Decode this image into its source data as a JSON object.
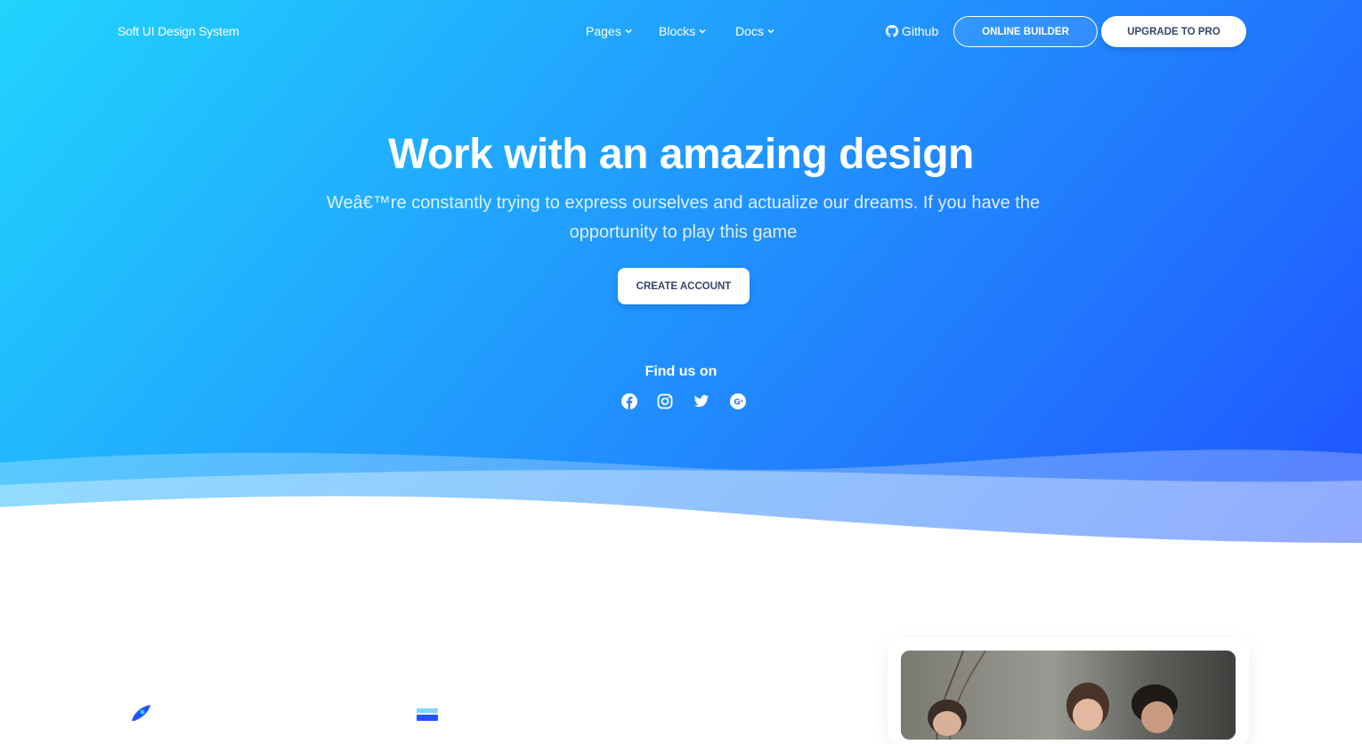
{
  "nav": {
    "brand": "Soft UI Design System",
    "menus": [
      {
        "label": "Pages"
      },
      {
        "label": "Blocks"
      },
      {
        "label": "Docs"
      }
    ],
    "github": "Github",
    "online_builder": "ONLINE BUILDER",
    "upgrade": "UPGRADE TO PRO"
  },
  "hero": {
    "title": "Work with an amazing design",
    "subtitle": "Weâ€™re constantly trying to express ourselves and actualize our dreams. If you have the opportunity to play this game",
    "cta": "CREATE ACCOUNT",
    "find_us": "Find us on",
    "social_icons": [
      "facebook-icon",
      "instagram-icon",
      "twitter-icon",
      "google-plus-icon"
    ]
  },
  "colors": {
    "gradient_start": "#21d4fd",
    "gradient_end": "#2152ff",
    "button_text": "#344767"
  }
}
